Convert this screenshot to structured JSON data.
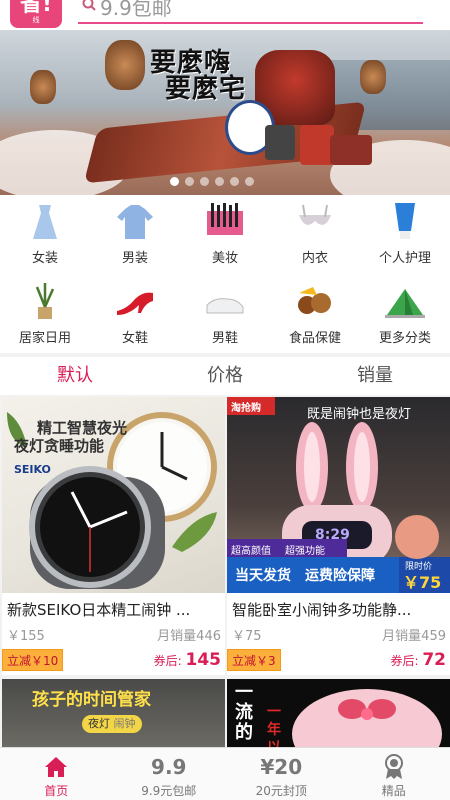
{
  "header": {
    "logo_text": "省!",
    "logo_sub": "线",
    "search_placeholder": "9.9包邮"
  },
  "banner": {
    "title_line1": "要麼嗨",
    "title_line2": "要麼宅",
    "slide_count": 6,
    "active_slide": 0
  },
  "categories": [
    {
      "label": "女装",
      "icon": "dress-icon"
    },
    {
      "label": "男装",
      "icon": "sweater-icon"
    },
    {
      "label": "美妆",
      "icon": "makeup-brushes-icon"
    },
    {
      "label": "内衣",
      "icon": "bra-icon"
    },
    {
      "label": "个人护理",
      "icon": "cream-tube-icon"
    },
    {
      "label": "居家日用",
      "icon": "plant-pot-icon"
    },
    {
      "label": "女鞋",
      "icon": "high-heel-icon"
    },
    {
      "label": "男鞋",
      "icon": "sneaker-icon"
    },
    {
      "label": "食品保健",
      "icon": "nuts-icon"
    },
    {
      "label": "更多分类",
      "icon": "tent-icon"
    }
  ],
  "sort_tabs": [
    {
      "label": "默认",
      "active": true
    },
    {
      "label": "价格",
      "active": false
    },
    {
      "label": "销量",
      "active": false
    }
  ],
  "products": [
    {
      "name": "新款SEIKO日本精工闹钟 ...",
      "price": "￥155",
      "sales": "月销量446",
      "coupon": "立减￥10",
      "after_label": "券后:",
      "after_price": "145",
      "img_text": [
        "精工智慧夜光",
        "夜灯贪睡功能"
      ],
      "brand": "SEIKO"
    },
    {
      "name": "智能卧室小闹钟多功能静...",
      "price": "￥75",
      "sales": "月销量459",
      "coupon": "立减￥3",
      "after_label": "券后:",
      "after_price": "72",
      "img_text": [
        "既是闹钟也是夜灯",
        "淘抢购",
        "超高颜值",
        "超强功能",
        "当天发货",
        "运费险保障",
        "限时价",
        "￥75",
        "8:29"
      ]
    },
    {
      "img_text": [
        "孩子的时间管家",
        "夜灯",
        "闹钟"
      ]
    },
    {
      "img_text": [
        "一",
        "流",
        "的",
        "一年",
        "以"
      ]
    }
  ],
  "bottom_nav": [
    {
      "label": "首页",
      "icon": "home-icon",
      "active": true
    },
    {
      "label": "9.9元包邮",
      "icon": "nine-nine-icon",
      "glyph": "9.9",
      "active": false
    },
    {
      "label": "20元封顶",
      "icon": "twenty-yuan-icon",
      "glyph": "¥20",
      "active": false
    },
    {
      "label": "精品",
      "icon": "award-icon",
      "active": false
    }
  ],
  "colors": {
    "accent": "#d91d55",
    "logo_bg": "#e8457a",
    "coupon_bg": "#fbb03b"
  }
}
